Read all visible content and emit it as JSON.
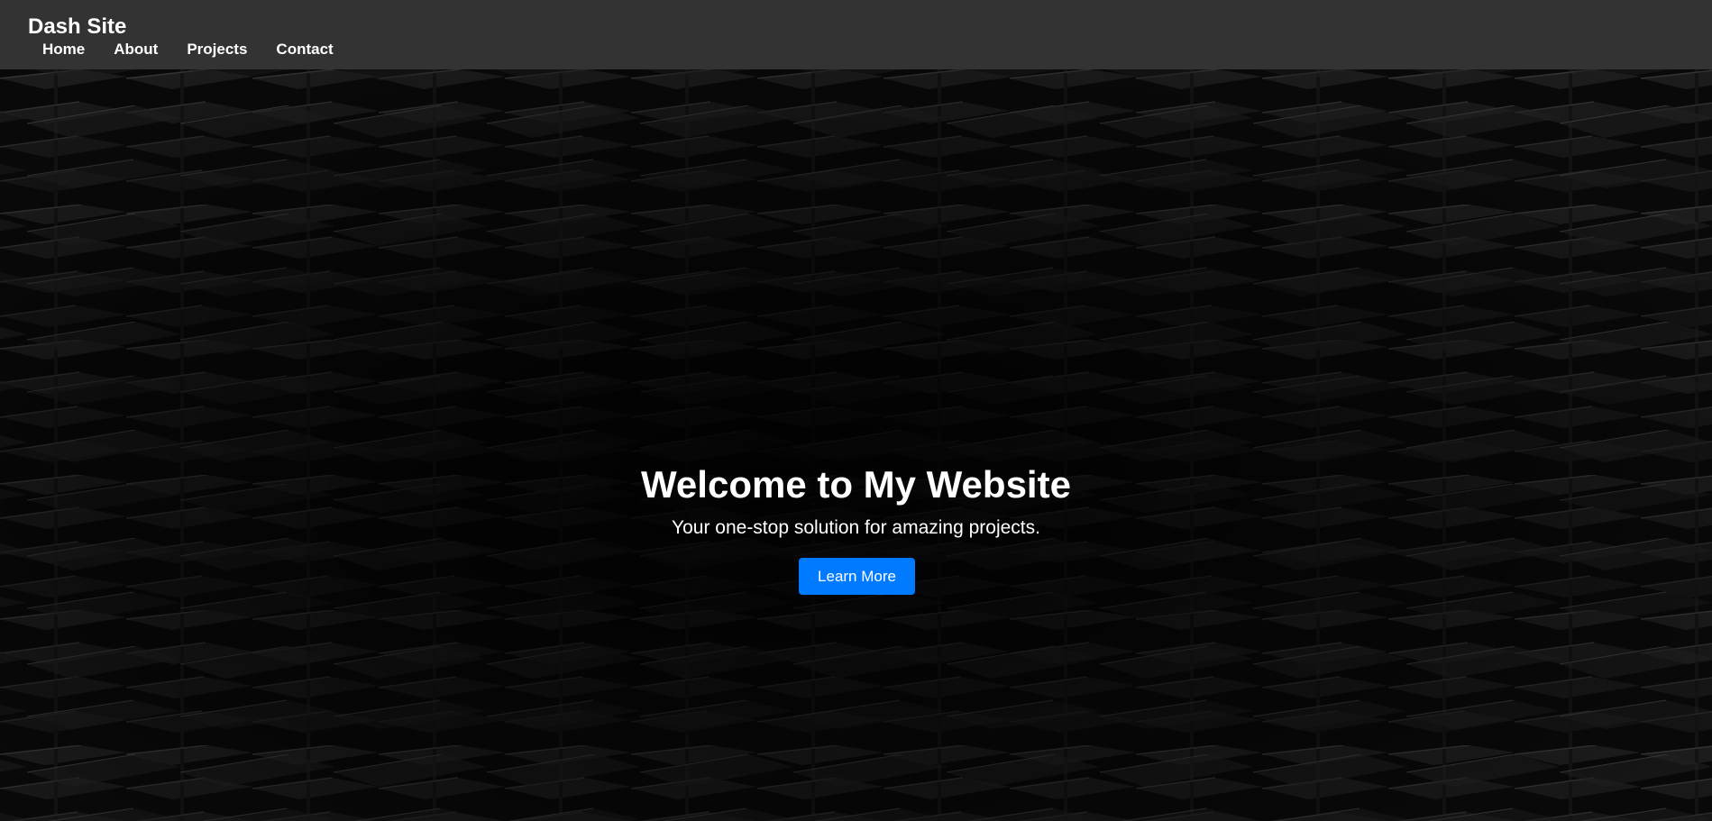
{
  "header": {
    "brand": "Dash Site",
    "nav": [
      {
        "label": "Home"
      },
      {
        "label": "About"
      },
      {
        "label": "Projects"
      },
      {
        "label": "Contact"
      }
    ]
  },
  "hero": {
    "title": "Welcome to My Website",
    "subtitle": "Your one-stop solution for amazing projects.",
    "cta_label": "Learn More",
    "background": "dark-abstract-staircase-pattern"
  },
  "colors": {
    "navbar": "#333333",
    "accent": "#007bff",
    "text": "#ffffff"
  }
}
